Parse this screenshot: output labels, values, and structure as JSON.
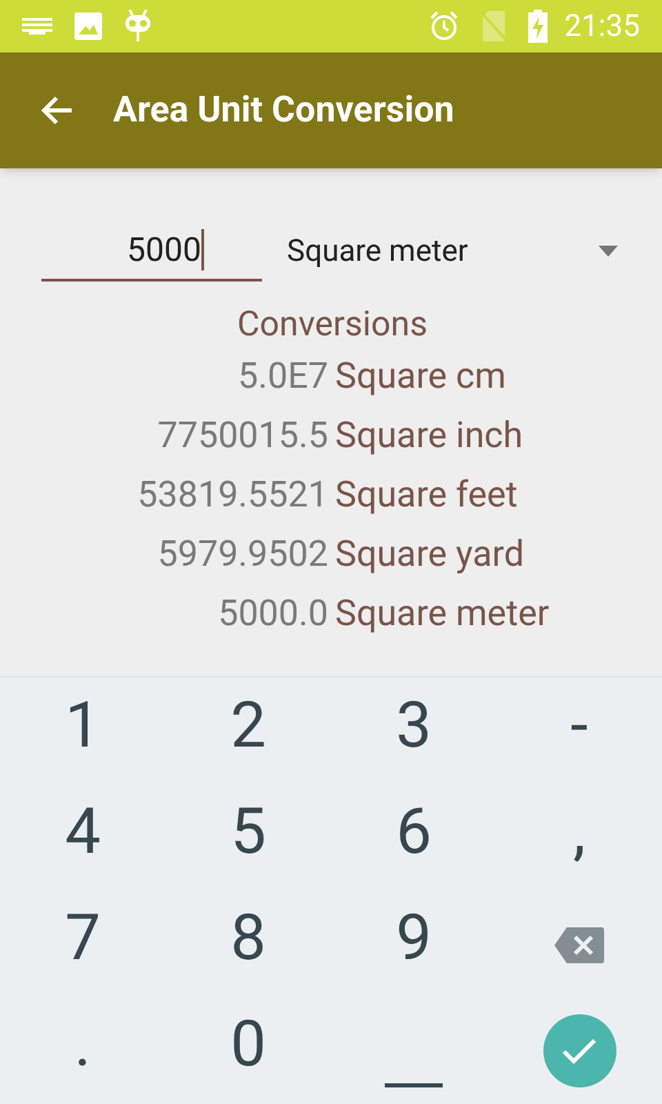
{
  "status_bar": {
    "time": "21:35"
  },
  "toolbar": {
    "title": "Area Unit Conversion"
  },
  "input": {
    "value": "5000"
  },
  "unit_select": {
    "value": "Square meter"
  },
  "conversions": {
    "heading": "Conversions",
    "rows": [
      {
        "value": "5.0E7",
        "unit": "Square cm"
      },
      {
        "value": "7750015.5",
        "unit": "Square inch"
      },
      {
        "value": "53819.5521",
        "unit": "Square feet"
      },
      {
        "value": "5979.9502",
        "unit": "Square yard"
      },
      {
        "value": "5000.0",
        "unit": "Square meter"
      }
    ]
  },
  "keyboard": {
    "keys": [
      {
        "kind": "char",
        "label": "1"
      },
      {
        "kind": "char",
        "label": "2"
      },
      {
        "kind": "char",
        "label": "3"
      },
      {
        "kind": "char",
        "label": "-"
      },
      {
        "kind": "char",
        "label": "4"
      },
      {
        "kind": "char",
        "label": "5"
      },
      {
        "kind": "char",
        "label": "6"
      },
      {
        "kind": "char",
        "label": ","
      },
      {
        "kind": "char",
        "label": "7"
      },
      {
        "kind": "char",
        "label": "8"
      },
      {
        "kind": "char",
        "label": "9"
      },
      {
        "kind": "backspace"
      },
      {
        "kind": "char",
        "label": "."
      },
      {
        "kind": "char",
        "label": "0"
      },
      {
        "kind": "space"
      },
      {
        "kind": "done"
      }
    ]
  }
}
